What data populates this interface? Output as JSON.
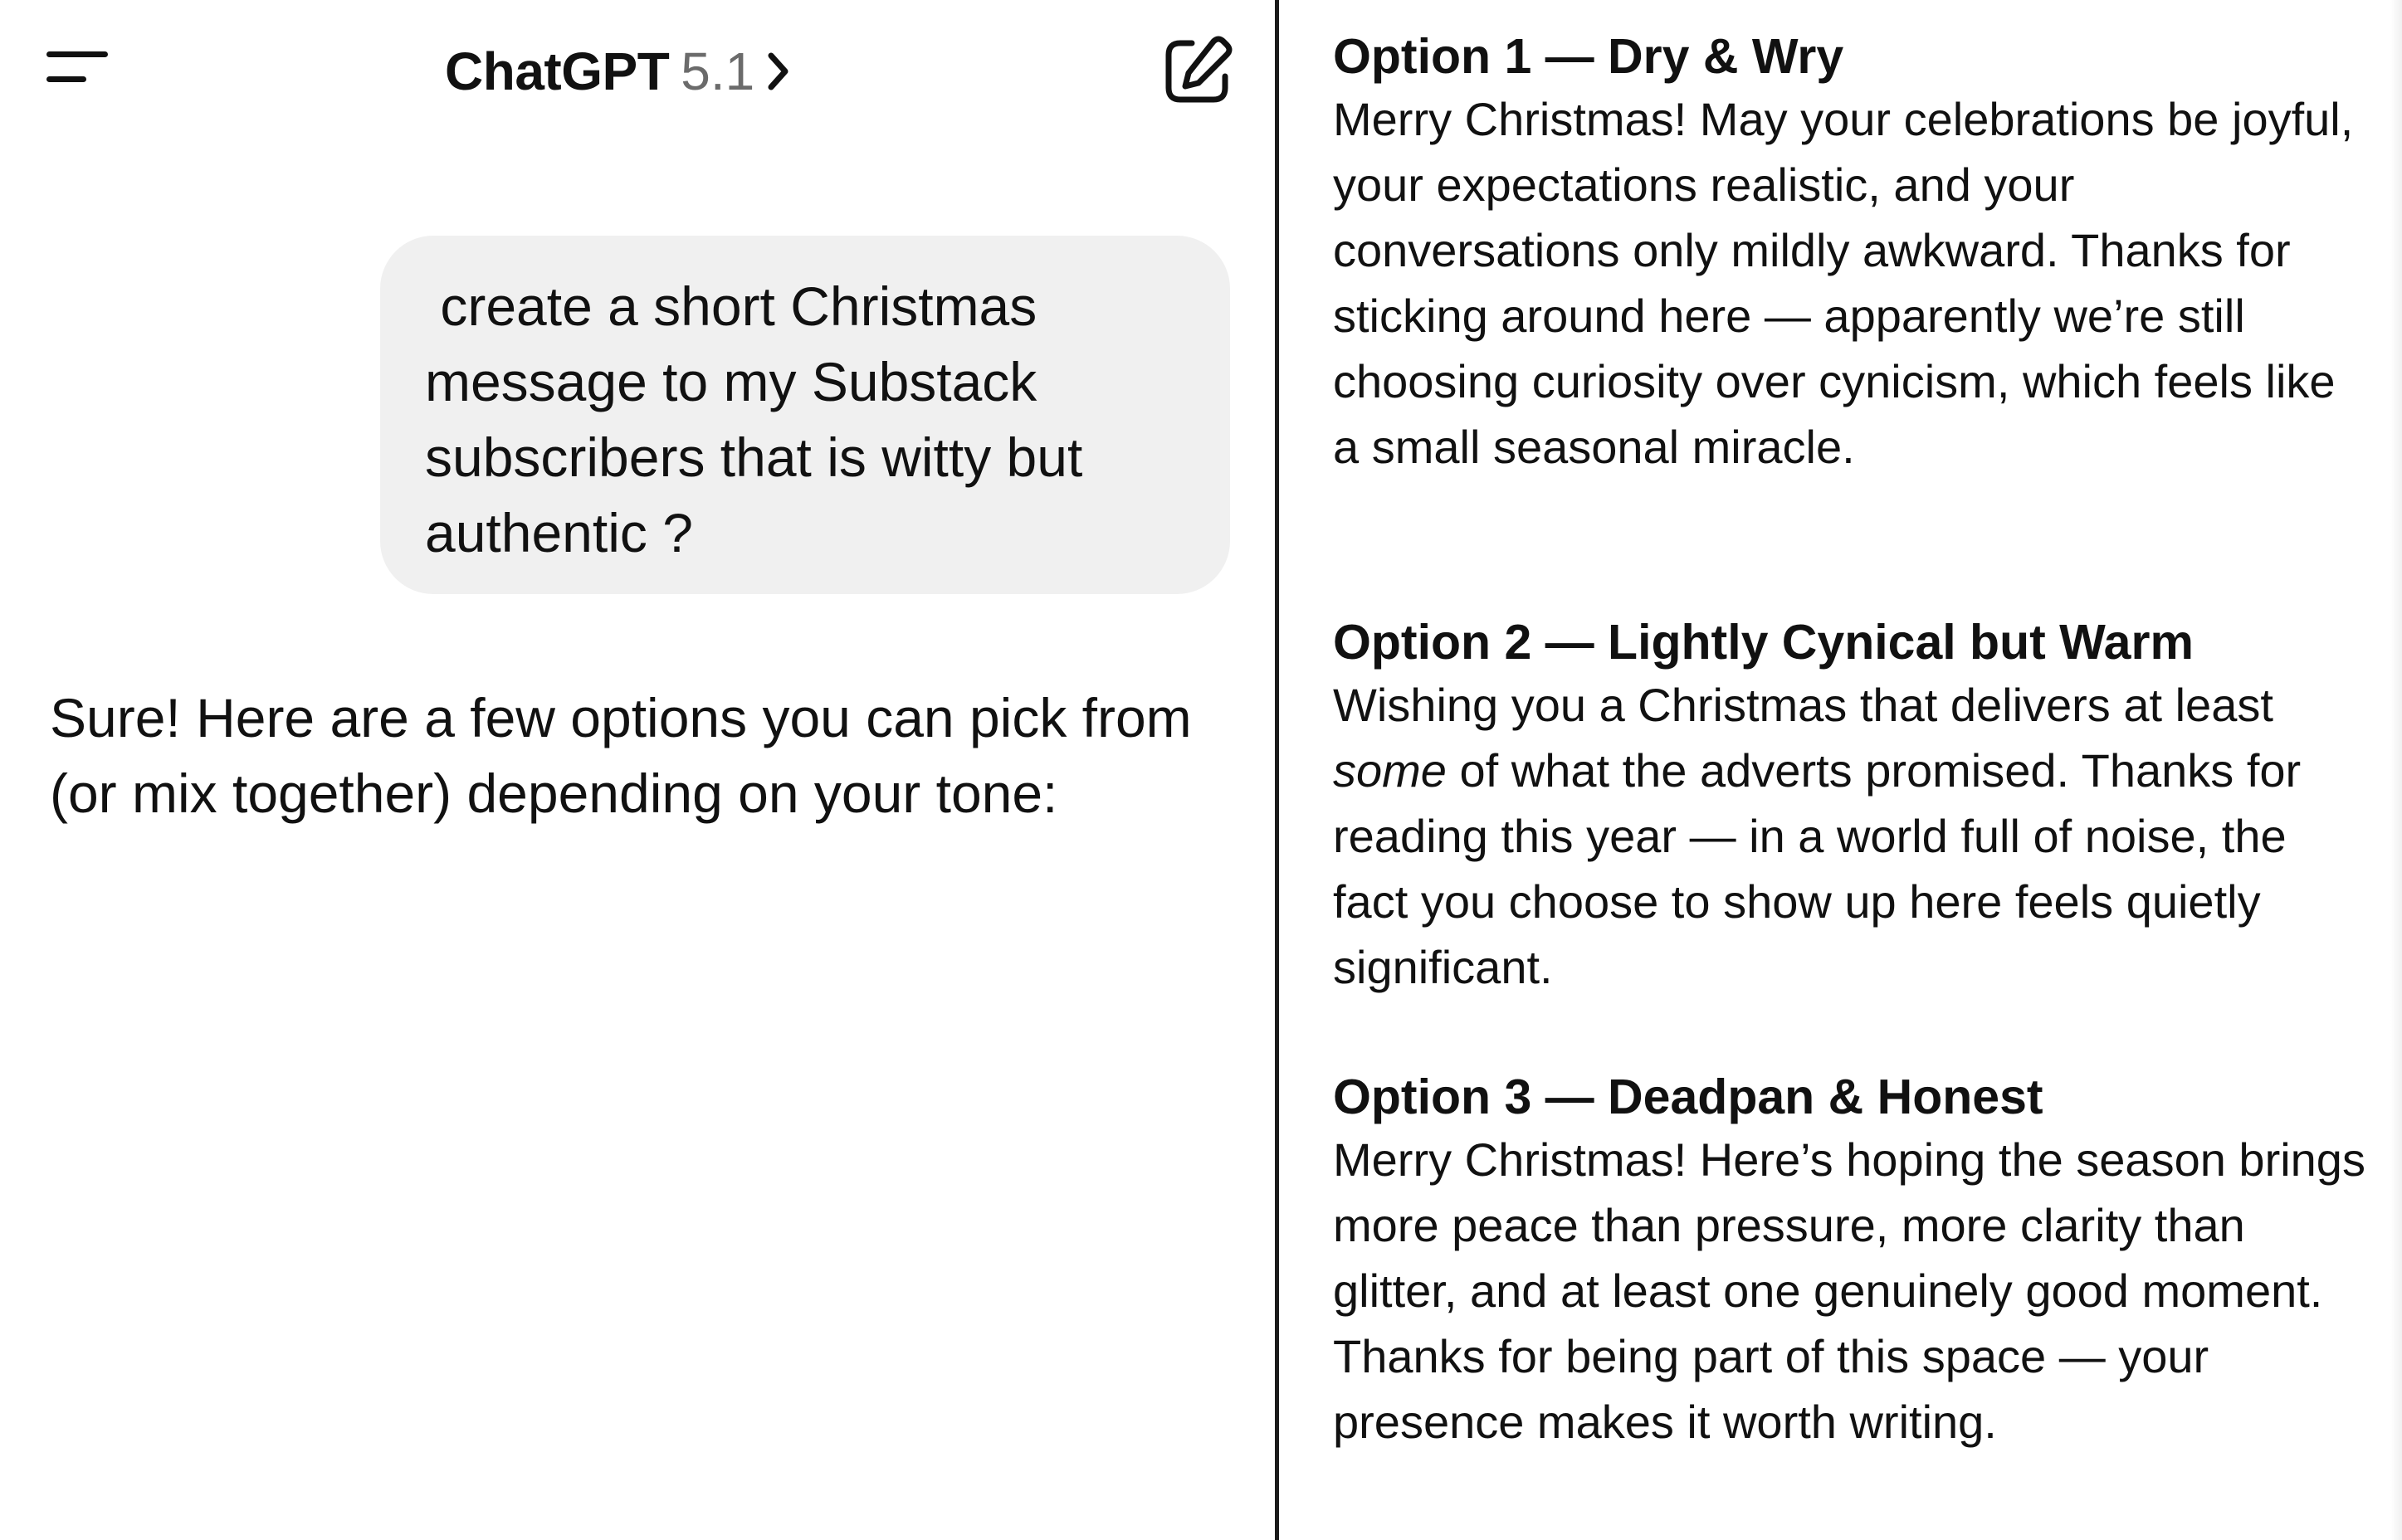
{
  "header": {
    "app_title": "ChatGPT",
    "model_version": "5.1",
    "menu_icon": "hamburger-menu-icon",
    "chevron_icon": "chevron-right-icon",
    "new_chat_icon": "compose-edit-icon"
  },
  "conversation": {
    "user_message": " create a short Christmas message to my Substack subscribers that is witty but authentic ?",
    "assistant_intro": "Sure! Here are a few options you can pick from (or mix together) depending on your tone:"
  },
  "options": [
    {
      "heading": "Option 1 — Dry & Wry",
      "body": "Merry Christmas! May your celebrations be joyful, your expectations realistic, and your conversations only mildly awkward. Thanks for sticking around here — apparently we’re still choosing curiosity over cynicism, which feels like a small seasonal miracle."
    },
    {
      "heading": "Option 2 — Lightly Cynical but Warm",
      "body_before": "Wishing you a Christmas that delivers at least ",
      "body_emphasis": "some",
      "body_after": " of what the adverts promised. Thanks for reading this year — in a world full of noise, the fact you choose to show up here feels quietly significant."
    },
    {
      "heading": "Option 3 — Deadpan & Honest",
      "body": "Merry Christmas! Here’s hoping the season brings more peace than pressure, more clarity than glitter, and at least one genuinely good moment. Thanks for being part of this space — your presence makes it worth writing."
    }
  ],
  "colors": {
    "text": "#111111",
    "muted_text": "#6b6b6b",
    "user_bubble": "#f0f0f0",
    "divider": "#1a1a1a",
    "background": "#ffffff"
  }
}
